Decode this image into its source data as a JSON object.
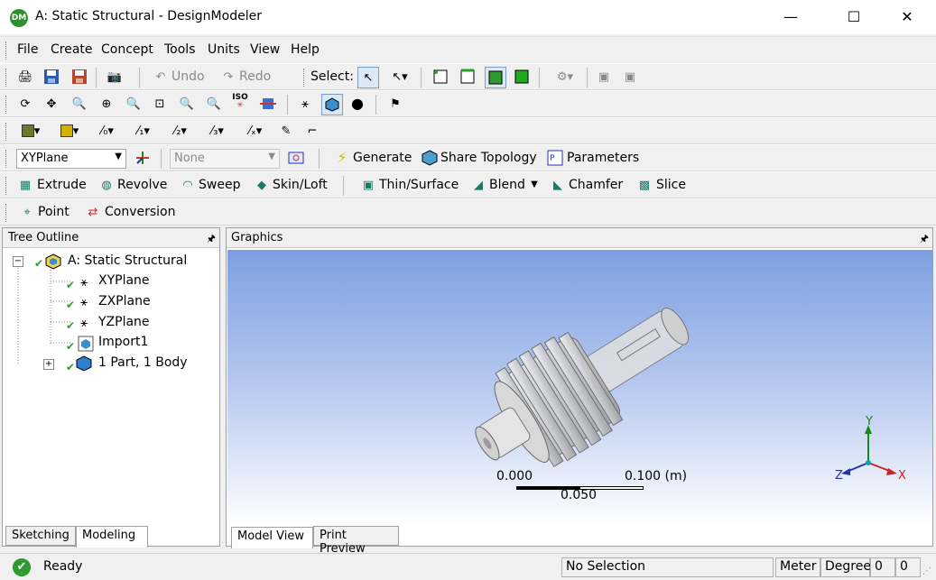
{
  "window": {
    "title": "A: Static Structural - DesignModeler",
    "icon_text": "DM",
    "minimize": "—",
    "maximize": "☐",
    "close": "✕"
  },
  "menu": [
    "File",
    "Create",
    "Concept",
    "Tools",
    "Units",
    "View",
    "Help"
  ],
  "toolbar1": {
    "undo": "Undo",
    "redo": "Redo",
    "select": "Select:"
  },
  "toolbar2": {
    "iso": "ISO"
  },
  "toolbar4": {
    "plane_value": "XYPlane",
    "sketch_value": "None",
    "generate": "Generate",
    "share_topology": "Share Topology",
    "parameters": "Parameters"
  },
  "toolbar5": {
    "extrude": "Extrude",
    "revolve": "Revolve",
    "sweep": "Sweep",
    "skin_loft": "Skin/Loft",
    "thin_surface": "Thin/Surface",
    "blend": "Blend",
    "chamfer": "Chamfer",
    "slice": "Slice"
  },
  "toolbar6": {
    "point": "Point",
    "conversion": "Conversion"
  },
  "tree": {
    "header": "Tree Outline",
    "pin": "🖈",
    "root": "A: Static Structural",
    "items": [
      "XYPlane",
      "ZXPlane",
      "YZPlane",
      "Import1",
      "1 Part, 1 Body"
    ],
    "expander_root": "−",
    "expander_part": "+"
  },
  "graphics": {
    "header": "Graphics",
    "pin": "🖈",
    "scale_left": "0.000",
    "scale_right": "0.100 (m)",
    "scale_mid": "0.050",
    "axis_x": "X",
    "axis_y": "Y",
    "axis_z": "Z"
  },
  "tabs_left": [
    "Sketching",
    "Modeling"
  ],
  "tabs_graphics": [
    "Model View",
    "Print Preview"
  ],
  "status": {
    "ready": "Ready",
    "selection": "No Selection",
    "units_length": "Meter",
    "units_angle": "Degree",
    "field1": "0",
    "field2": "0"
  },
  "colors": {
    "viewport_top": "#7d9fe0",
    "ok_green": "#2e9b2e",
    "axis_x": "#cc2222",
    "axis_y": "#1a8a1a",
    "axis_z": "#2233aa"
  }
}
